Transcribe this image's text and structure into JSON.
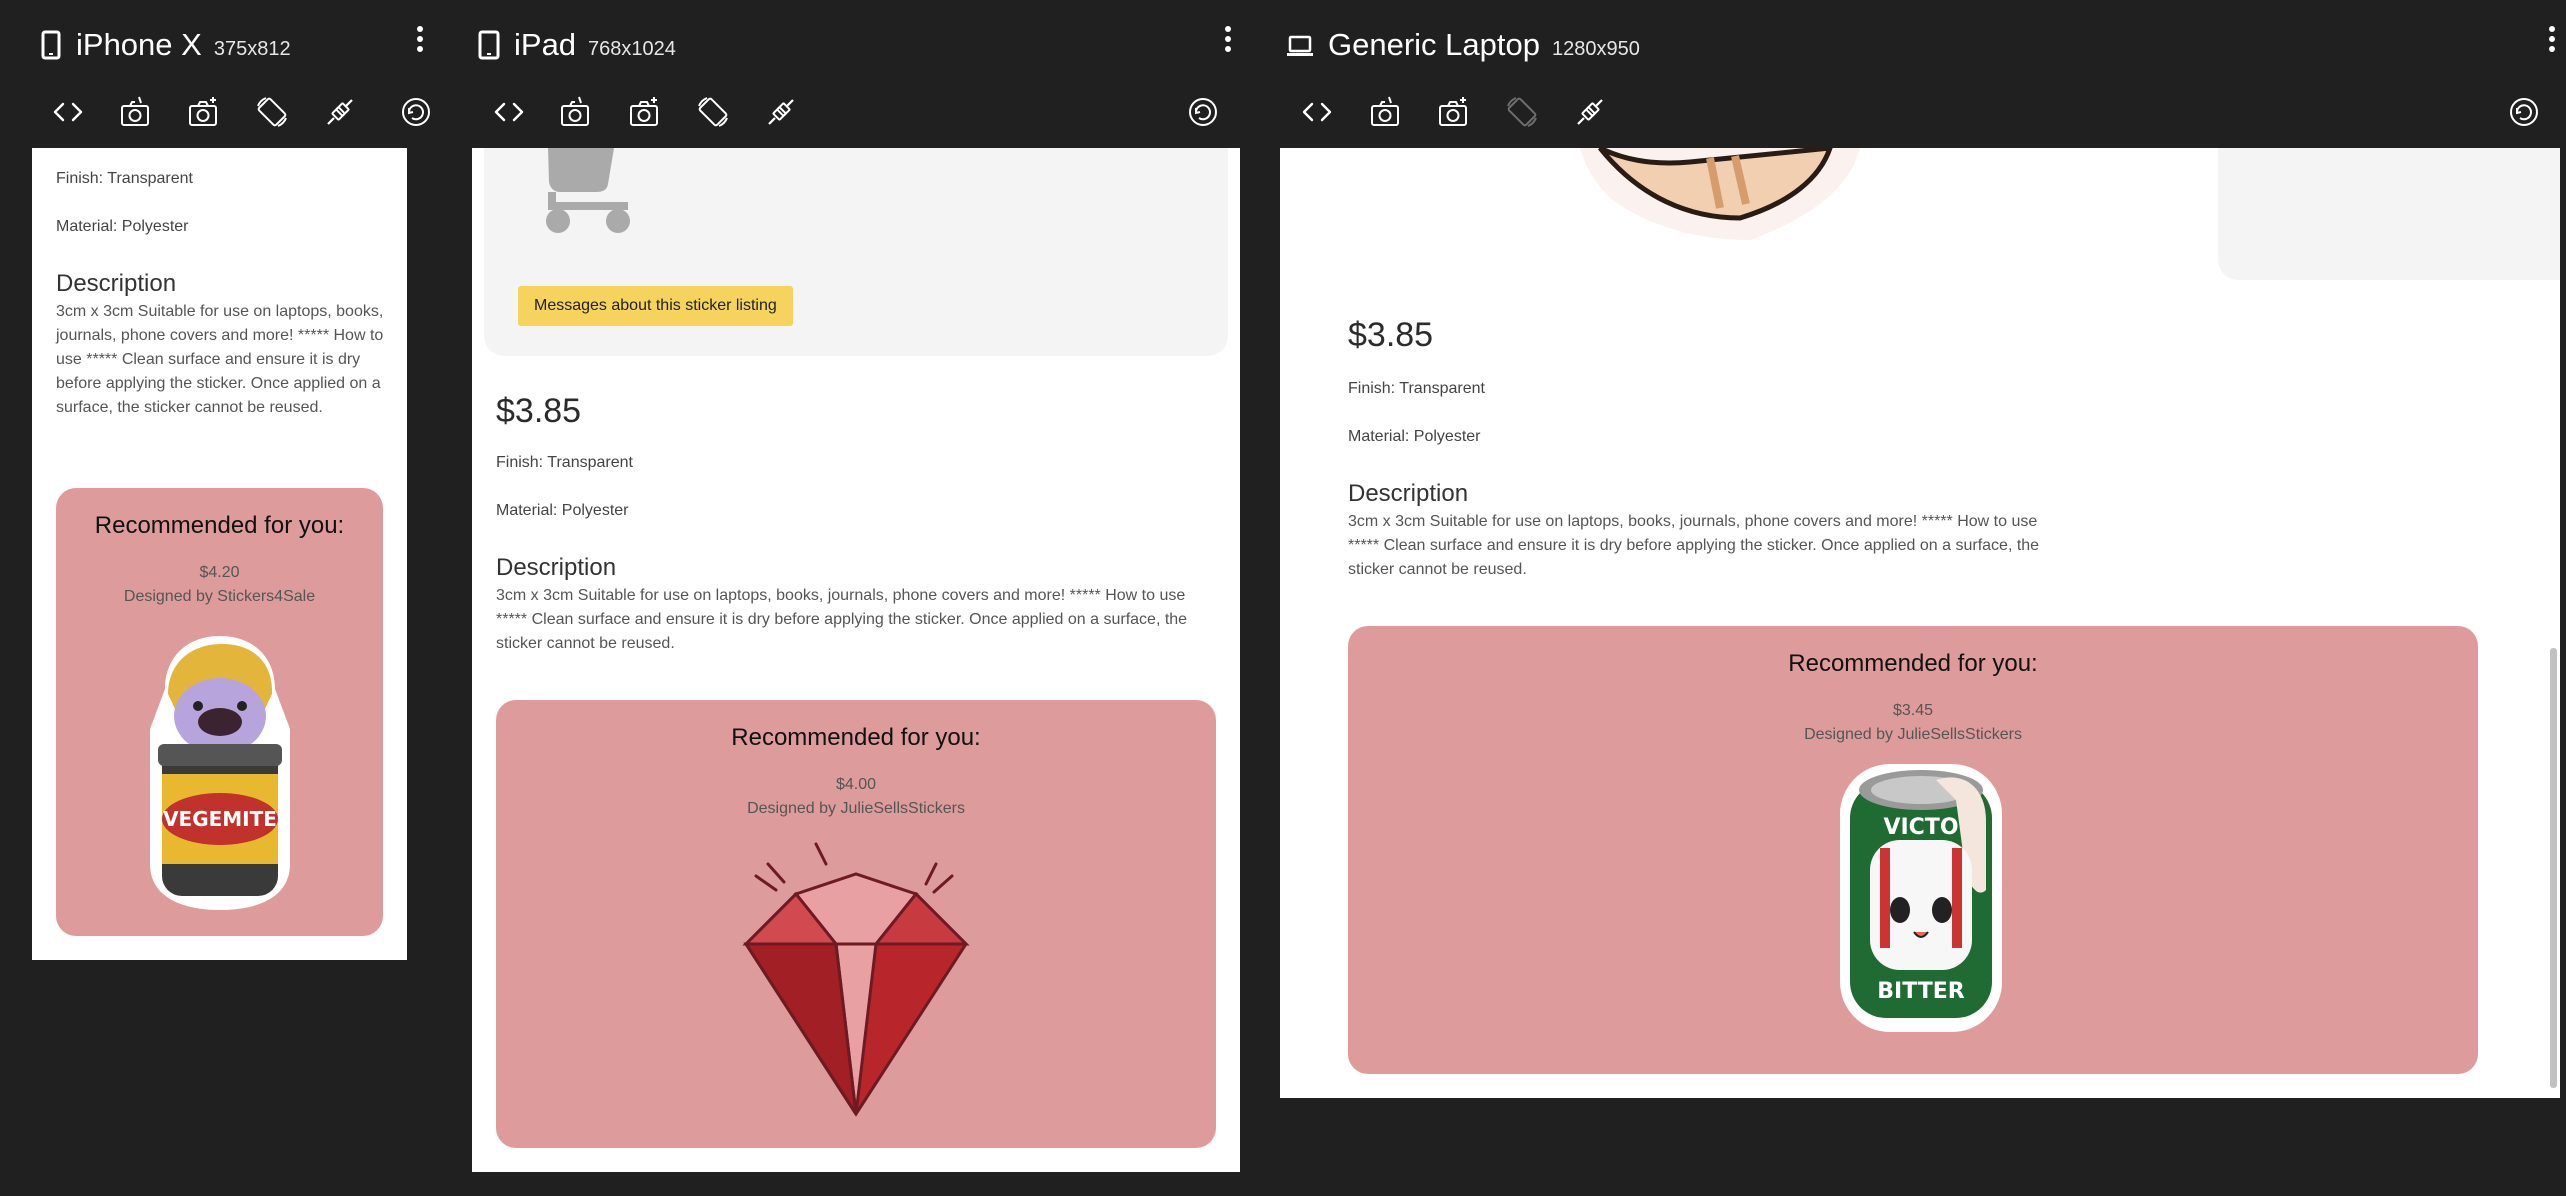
{
  "devices": [
    {
      "name": "iPhone X",
      "size": "375x812",
      "icon": "phone-icon"
    },
    {
      "name": "iPad",
      "size": "768x1024",
      "icon": "tablet-icon"
    },
    {
      "name": "Generic Laptop",
      "size": "1280x950",
      "icon": "laptop-icon"
    }
  ],
  "product": {
    "price": "$3.85",
    "finish": "Finish: Transparent",
    "material": "Material: Polyester",
    "description_title": "Description",
    "description": " 3cm x 3cm Suitable for use on laptops, books, journals, phone covers and more! ***** How to use ***** Clean surface and ensure it is dry before applying the sticker. Once applied on a surface, the sticker cannot be reused.",
    "messages_button": "Messages about this sticker listing"
  },
  "recommendations": {
    "title": "Recommended for you:",
    "phone": {
      "price": "$4.20",
      "designer": "Designed by Stickers4Sale",
      "sticker": "vegemite-sticker"
    },
    "tablet": {
      "price": "$4.00",
      "designer": "Designed by JulieSellsStickers",
      "sticker": "ruby-gem-sticker"
    },
    "laptop": {
      "price": "$3.45",
      "designer": "Designed by JulieSellsStickers",
      "sticker": "victoria-bitter-can-sticker"
    }
  },
  "colors": {
    "background": "#202020",
    "recommend_card": "#de9b9b",
    "message_button": "#f6d35c"
  }
}
